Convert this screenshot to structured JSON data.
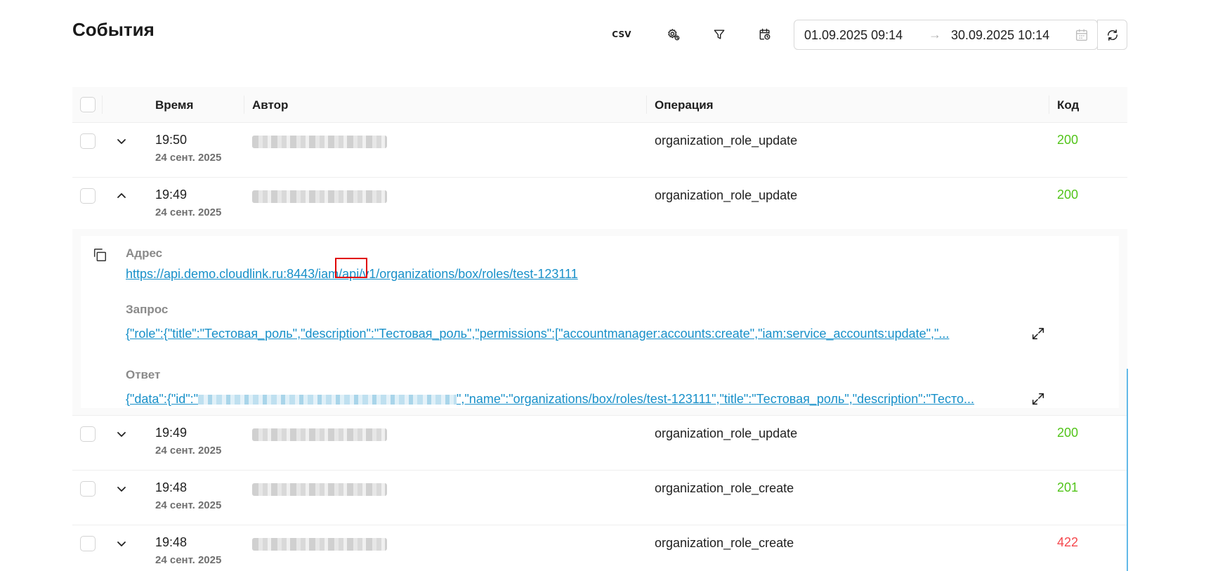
{
  "header": {
    "title": "События",
    "csv_label": "CSV",
    "range_start": "01.09.2025 09:14",
    "range_sep": "→",
    "range_end": "30.09.2025 10:14"
  },
  "table": {
    "columns": [
      "Время",
      "Автор",
      "Операция",
      "Код"
    ]
  },
  "rows": [
    {
      "time": "19:50",
      "date": "24 сент. 2025",
      "operation": "organization_role_update",
      "code": "200",
      "expanded": false
    },
    {
      "time": "19:49",
      "date": "24 сент. 2025",
      "operation": "organization_role_update",
      "code": "200",
      "expanded": true
    },
    {
      "time": "19:49",
      "date": "24 сент. 2025",
      "operation": "organization_role_update",
      "code": "200",
      "expanded": false
    },
    {
      "time": "19:48",
      "date": "24 сент. 2025",
      "operation": "organization_role_create",
      "code": "201",
      "expanded": false
    },
    {
      "time": "19:48",
      "date": "24 сент. 2025",
      "operation": "organization_role_create",
      "code": "422",
      "expanded": false
    }
  ],
  "details": {
    "address_label": "Адрес",
    "address_url": "https://api.demo.cloudlink.ru:8443/iam/api/v1/organizations/box/roles/test-123111",
    "request_label": "Запрос",
    "request_body": "{\"role\":{\"title\":\"Тестовая_роль\",\"description\":\"Тестовая_роль\",\"permissions\":[\"accountmanager:accounts:create\",\"iam:service_accounts:update\",\"...",
    "response_label": "Ответ",
    "response_prefix": "{\"data\":{\"id\":\"",
    "response_suffix": "\",\"name\":\"organizations/box/roles/test-123111\",\"title\":\"Тестовая_роль\",\"description\":\"Тесто..."
  },
  "colors": {
    "code_ok": "#52c41a",
    "code_err": "#f5484d",
    "link": "#1890c9",
    "highlight": "#e00000"
  },
  "icons": [
    "csv-export-icon",
    "settings-gear-icon",
    "filter-icon",
    "calendar-clock-icon",
    "calendar-icon",
    "refresh-icon",
    "chevron-down-icon",
    "chevron-up-icon",
    "copy-icon",
    "expand-icon"
  ]
}
